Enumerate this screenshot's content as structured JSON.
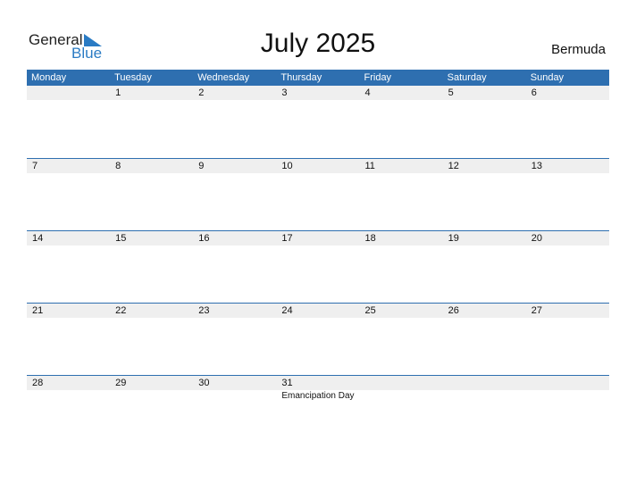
{
  "logo": {
    "general": "General",
    "blue": "Blue"
  },
  "title": "July 2025",
  "country": "Bermuda",
  "days": [
    "Monday",
    "Tuesday",
    "Wednesday",
    "Thursday",
    "Friday",
    "Saturday",
    "Sunday"
  ],
  "weeks": [
    {
      "dates": [
        "",
        "1",
        "2",
        "3",
        "4",
        "5",
        "6"
      ],
      "events": [
        "",
        "",
        "",
        "",
        "",
        "",
        ""
      ]
    },
    {
      "dates": [
        "7",
        "8",
        "9",
        "10",
        "11",
        "12",
        "13"
      ],
      "events": [
        "",
        "",
        "",
        "",
        "",
        "",
        ""
      ]
    },
    {
      "dates": [
        "14",
        "15",
        "16",
        "17",
        "18",
        "19",
        "20"
      ],
      "events": [
        "",
        "",
        "",
        "",
        "",
        "",
        ""
      ]
    },
    {
      "dates": [
        "21",
        "22",
        "23",
        "24",
        "25",
        "26",
        "27"
      ],
      "events": [
        "",
        "",
        "",
        "",
        "",
        "",
        ""
      ]
    },
    {
      "dates": [
        "28",
        "29",
        "30",
        "31",
        "",
        "",
        ""
      ],
      "events": [
        "",
        "",
        "",
        "Emancipation Day",
        "",
        "",
        ""
      ]
    }
  ],
  "colors": {
    "accent": "#2e6fb0",
    "row_bg": "#efefef",
    "logo_blue": "#2a7bc4"
  }
}
